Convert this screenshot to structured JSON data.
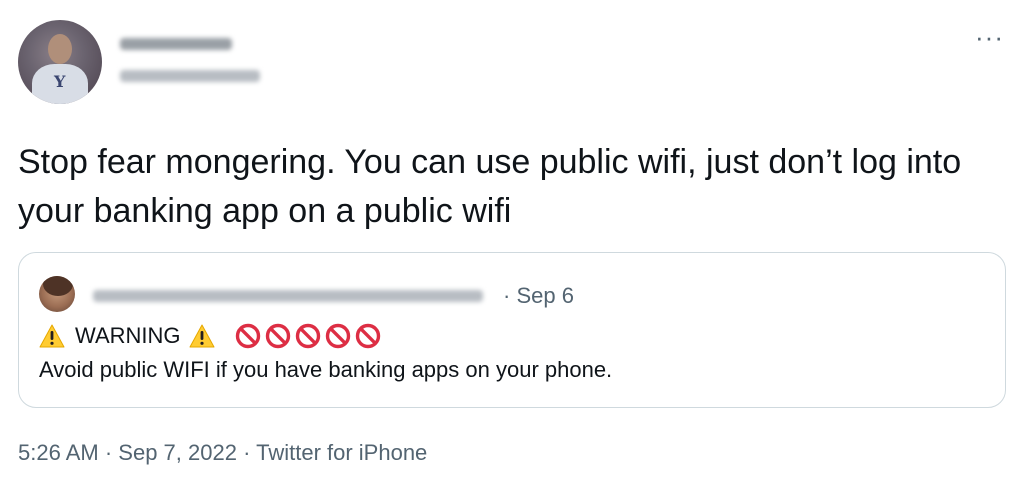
{
  "tweet": {
    "text": "Stop fear mongering. You can use public wifi, just don’t log into your banking app on a public wifi",
    "avatar_icon": "user-avatar"
  },
  "menu": {
    "more_label": "···"
  },
  "quote": {
    "date": "· Sep 6",
    "warning_word": "WARNING",
    "body": "Avoid public WIFI if you have banking apps on your phone."
  },
  "footer": {
    "time": "5:26 AM",
    "separator": " · ",
    "date": "Sep 7, 2022",
    "source": "Twitter for iPhone"
  },
  "colors": {
    "text_primary": "#0f1419",
    "text_secondary": "#536471",
    "border": "#cfd9de",
    "warning_yellow": "#ffcc32",
    "no_entry_red": "#dd2e44"
  }
}
